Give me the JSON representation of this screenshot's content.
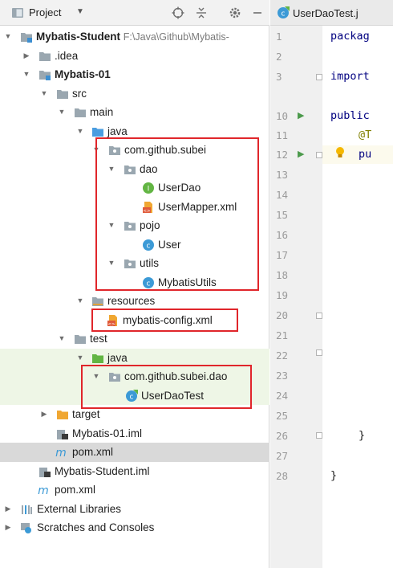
{
  "panel": {
    "title": "Project",
    "dropdown": "▼"
  },
  "tree": [
    {
      "id": "root",
      "label": "Mybatis-Student",
      "path": "F:\\Java\\Github\\Mybatis-",
      "bold": true
    },
    {
      "id": "idea",
      "label": ".idea"
    },
    {
      "id": "mod",
      "label": "Mybatis-01",
      "bold": true
    },
    {
      "id": "src",
      "label": "src"
    },
    {
      "id": "main",
      "label": "main"
    },
    {
      "id": "java",
      "label": "java"
    },
    {
      "id": "pkg",
      "label": "com.github.subei"
    },
    {
      "id": "dao",
      "label": "dao"
    },
    {
      "id": "userdao",
      "label": "UserDao"
    },
    {
      "id": "usermapper",
      "label": "UserMapper.xml"
    },
    {
      "id": "pojo",
      "label": "pojo"
    },
    {
      "id": "user",
      "label": "User"
    },
    {
      "id": "utils",
      "label": "utils"
    },
    {
      "id": "mybatisutils",
      "label": "MybatisUtils"
    },
    {
      "id": "resources",
      "label": "resources"
    },
    {
      "id": "mybatisconfig",
      "label": "mybatis-config.xml"
    },
    {
      "id": "test",
      "label": "test"
    },
    {
      "id": "testjava",
      "label": "java"
    },
    {
      "id": "testpkg",
      "label": "com.github.subei.dao"
    },
    {
      "id": "userdaotest",
      "label": "UserDaoTest"
    },
    {
      "id": "target",
      "label": "target"
    },
    {
      "id": "iml1",
      "label": "Mybatis-01.iml"
    },
    {
      "id": "pom1",
      "label": "pom.xml"
    },
    {
      "id": "iml2",
      "label": "Mybatis-Student.iml"
    },
    {
      "id": "pom2",
      "label": "pom.xml"
    },
    {
      "id": "extlibs",
      "label": "External Libraries"
    },
    {
      "id": "scratches",
      "label": "Scratches and Consoles"
    }
  ],
  "editor": {
    "tab_label": "UserDaoTest.j",
    "line_numbers": [
      "1",
      "2",
      "3",
      "10",
      "11",
      "12",
      "13",
      "14",
      "15",
      "16",
      "17",
      "18",
      "19",
      "20",
      "21",
      "22",
      "23",
      "24",
      "25",
      "26",
      "27",
      "28"
    ],
    "code": {
      "l1": "packag",
      "l3": "import",
      "l10": "public",
      "l11": "@T",
      "l12": "pu",
      "l26": "}",
      "l28": "}"
    }
  }
}
